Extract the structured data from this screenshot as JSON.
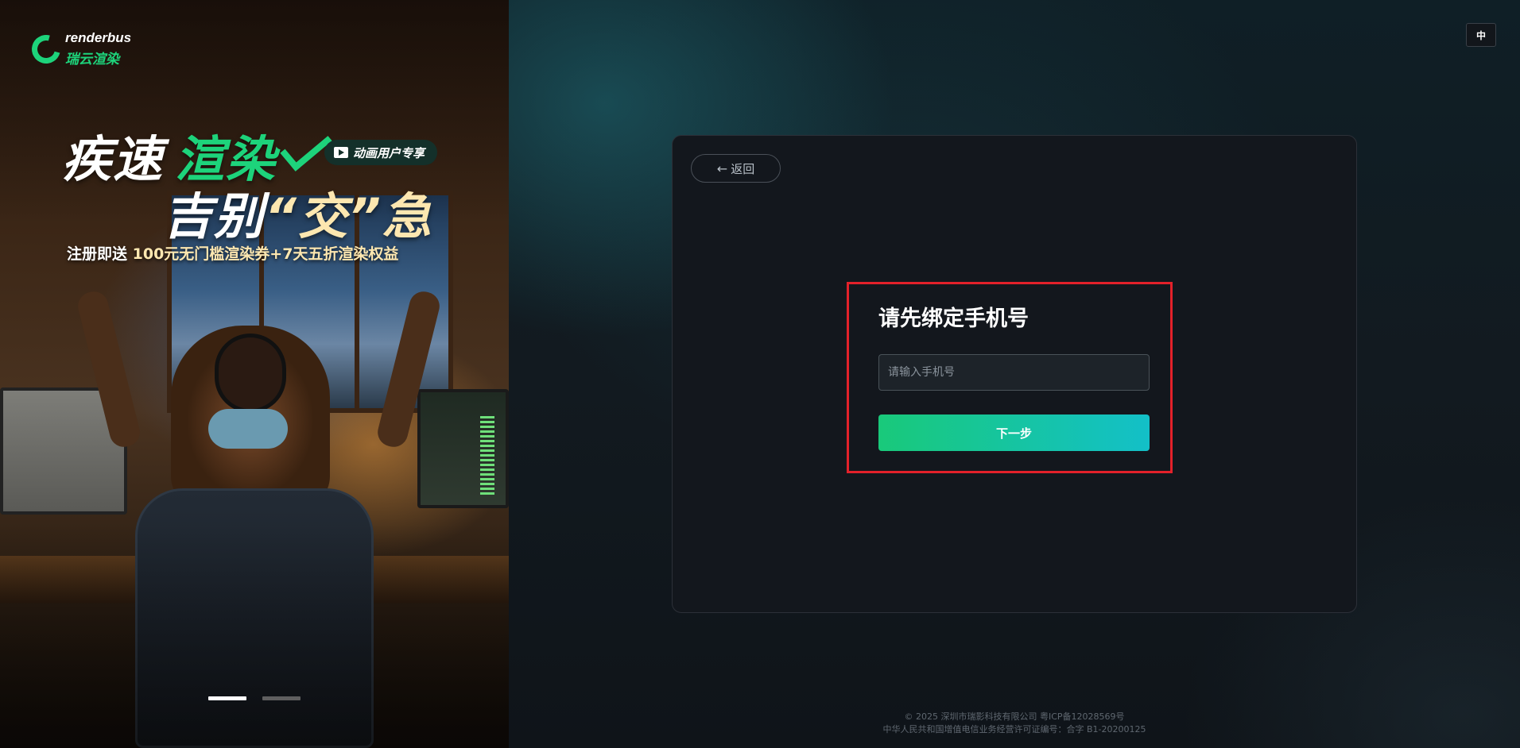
{
  "promo": {
    "logo_en": "renderbus",
    "logo_cn": "瑞云渲染",
    "headline_part1": "疾速",
    "headline_part2": "渲染",
    "badge": "动画用户专享",
    "headline_line2_a": "吉别",
    "headline_line2_b": "“交”急",
    "sub_a": "注册即送 ",
    "sub_b": "100元无门槛渲染券+7天五折渲染权益",
    "carousel_active_index": 0,
    "carousel_count": 2
  },
  "header": {
    "lang_label": "中"
  },
  "card": {
    "back_label": "返回",
    "title": "请先绑定手机号",
    "phone_placeholder": "请输入手机号",
    "phone_value": "",
    "next_label": "下一步"
  },
  "footer": {
    "line1": "© 2025 深圳市瑞影科技有限公司 粤ICP备12028569号",
    "line2": "中华人民共和国增值电信业务经营许可证编号：合字 B1-20200125"
  },
  "colors": {
    "accent_green": "#1dd37b",
    "button_gradient_start": "#19c97a",
    "button_gradient_end": "#13c0c8",
    "highlight_red": "#e3212a"
  }
}
